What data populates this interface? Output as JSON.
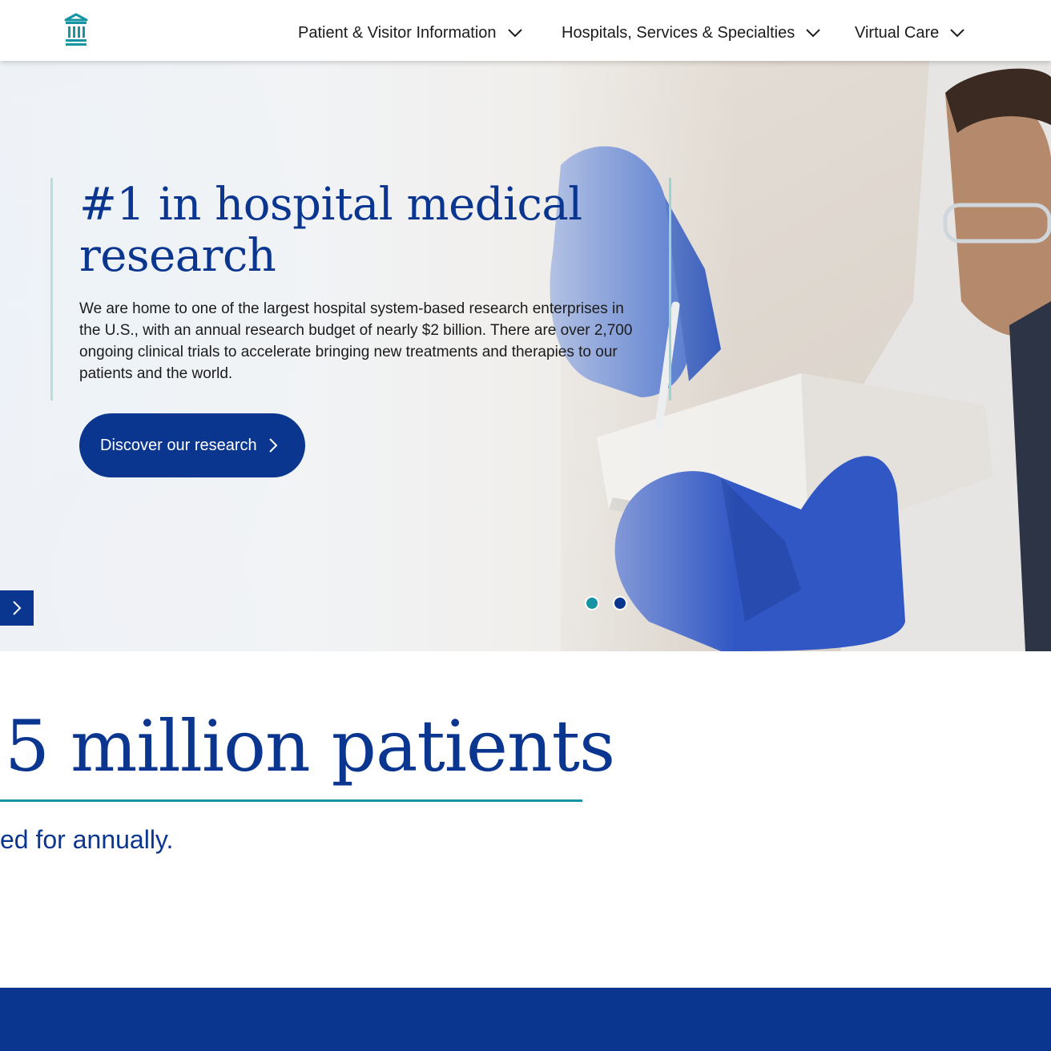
{
  "header": {
    "nav": [
      {
        "label": "Patient & Visitor Information"
      },
      {
        "label": "Hospitals, Services & Specialties"
      },
      {
        "label": "Virtual Care"
      }
    ]
  },
  "hero": {
    "title": "#1 in hospital medical research",
    "body": "We are home to one of the largest hospital system-based research enterprises in the U.S., with an annual research budget of nearly $2 billion. There are over 2,700 ongoing clinical trials to accelerate bringing new treatments and therapies to our patients and the world.",
    "cta_label": "Discover our research",
    "carousel": {
      "slides": 2,
      "active_index": 0
    }
  },
  "stats": {
    "number_text": "5 million patients",
    "caption": "ed for annually."
  },
  "colors": {
    "brand_navy": "#0b3690",
    "accent_teal": "#1595a3"
  },
  "icons": {
    "logo": "building-columns-logo",
    "nav_chevron": "chevron-down-icon",
    "cta_chevron": "chevron-right-icon",
    "carousel_next": "chevron-right-icon"
  }
}
